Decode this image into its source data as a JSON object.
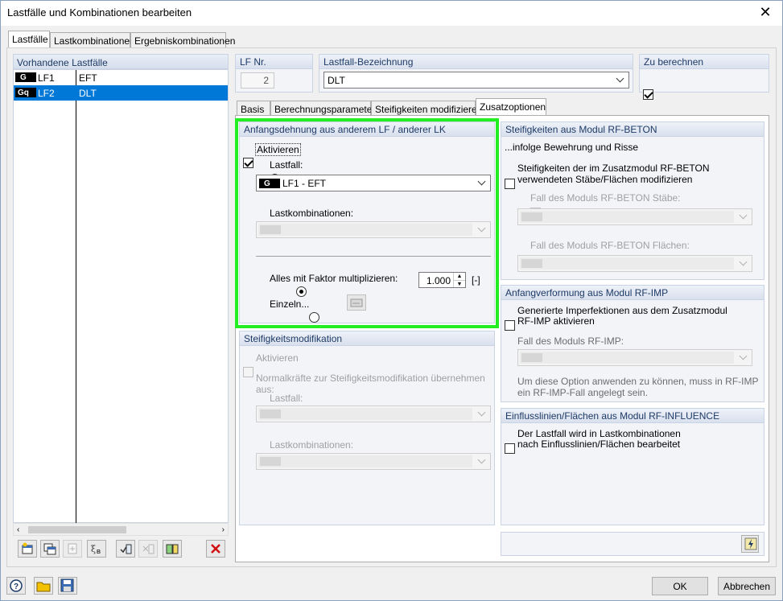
{
  "window": {
    "title": "Lastfälle und Kombinationen bearbeiten",
    "close_glyph": "✕"
  },
  "top_tabs": [
    "Lastfälle",
    "Lastkombinationen",
    "Ergebniskombinationen"
  ],
  "load_cases": {
    "header": "Vorhandene Lastfälle",
    "rows": [
      {
        "badge": "G",
        "nr": "LF1",
        "name": "EFT"
      },
      {
        "badge": "Gq",
        "nr": "LF2",
        "name": "DLT"
      }
    ]
  },
  "header": {
    "lf_nr_label": "LF Nr.",
    "lf_nr_value": "2",
    "designation_label": "Lastfall-Bezeichnung",
    "designation_value": "DLT",
    "calc_label": "Zu berechnen"
  },
  "sub_tabs": [
    "Basis",
    "Berechnungsparameter",
    "Steifigkeiten modifizieren",
    "Zusatzoptionen"
  ],
  "initial_strain": {
    "title": "Anfangsdehnung aus anderem LF / anderer LK",
    "activate": "Aktivieren",
    "loadcase_label": "Lastfall:",
    "loadcase_badge": "G",
    "loadcase_value": "LF1 - EFT",
    "combinations_label": "Lastkombinationen:",
    "multiply_label": "Alles mit Faktor multiplizieren:",
    "factor_value": "1.000",
    "factor_unit": "[-]",
    "individual_label": "Einzeln..."
  },
  "stiffness_mod": {
    "title": "Steifigkeitsmodifikation",
    "activate": "Aktivieren",
    "description": "Normalkräfte zur Steifigkeitsmodifikation übernehmen aus:",
    "loadcase_label": "Lastfall:",
    "combinations_label": "Lastkombinationen:"
  },
  "rf_beton": {
    "title": "Steifigkeiten aus Modul RF-BETON",
    "subtitle": "...infolge Bewehrung und Risse",
    "modify_line1": "Steifigkeiten der im Zusatzmodul RF-BETON",
    "modify_line2": "verwendeten Stäbe/Flächen modifizieren",
    "members_case": "Fall des Moduls RF-BETON Stäbe:",
    "surfaces_case": "Fall des Moduls RF-BETON Flächen:"
  },
  "rf_imp": {
    "title": "Anfangverformung aus Modul RF-IMP",
    "activate_line1": "Generierte Imperfektionen aus dem Zusatzmodul",
    "activate_line2": "RF-IMP aktivieren",
    "case_label": "Fall des Moduls RF-IMP:",
    "hint_line1": "Um diese Option anwenden zu können, muss in RF-IMP",
    "hint_line2": "ein RF-IMP-Fall angelegt sein."
  },
  "rf_influence": {
    "title": "Einflusslinien/Flächen aus Modul RF-INFLUENCE",
    "line1": "Der Lastfall wird in Lastkombinationen",
    "line2": "nach Einflusslinien/Flächen bearbeitet"
  },
  "footer": {
    "ok": "OK",
    "cancel": "Abbrechen"
  },
  "colors": {
    "highlight": "#22ee22",
    "selection": "#0078d7",
    "group_title": "#1e3a66"
  }
}
